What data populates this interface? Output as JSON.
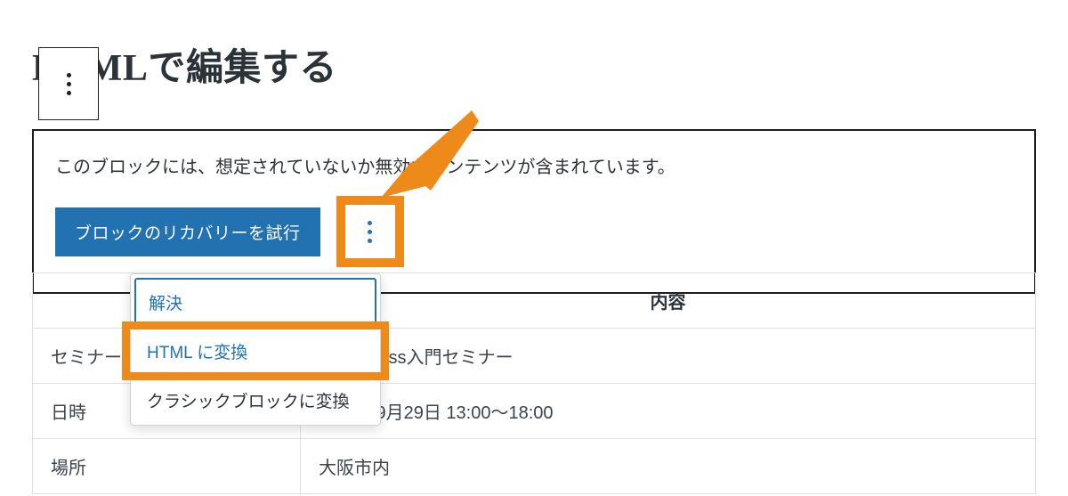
{
  "title": "HTMLで編集する",
  "warning": {
    "message": "このブロックには、想定されていないか無効なコンテンツが含まれています。",
    "recover_label": "ブロックのリカバリーを試行"
  },
  "popover": {
    "resolve_label": "解決",
    "convert_html_label": "HTML に変換",
    "convert_classic_label": "クラシックブロックに変換"
  },
  "table": {
    "header_col1": "",
    "header_col2": "内容",
    "rows": [
      {
        "label": "セミナー",
        "value": "WordPress入門セミナー"
      },
      {
        "label": "日時",
        "value": "2024年9月29日 13:00〜18:00"
      },
      {
        "label": "場所",
        "value": "大阪市内"
      }
    ]
  },
  "colors": {
    "accent_orange": "#ed8a19",
    "primary_blue": "#2271b1"
  }
}
